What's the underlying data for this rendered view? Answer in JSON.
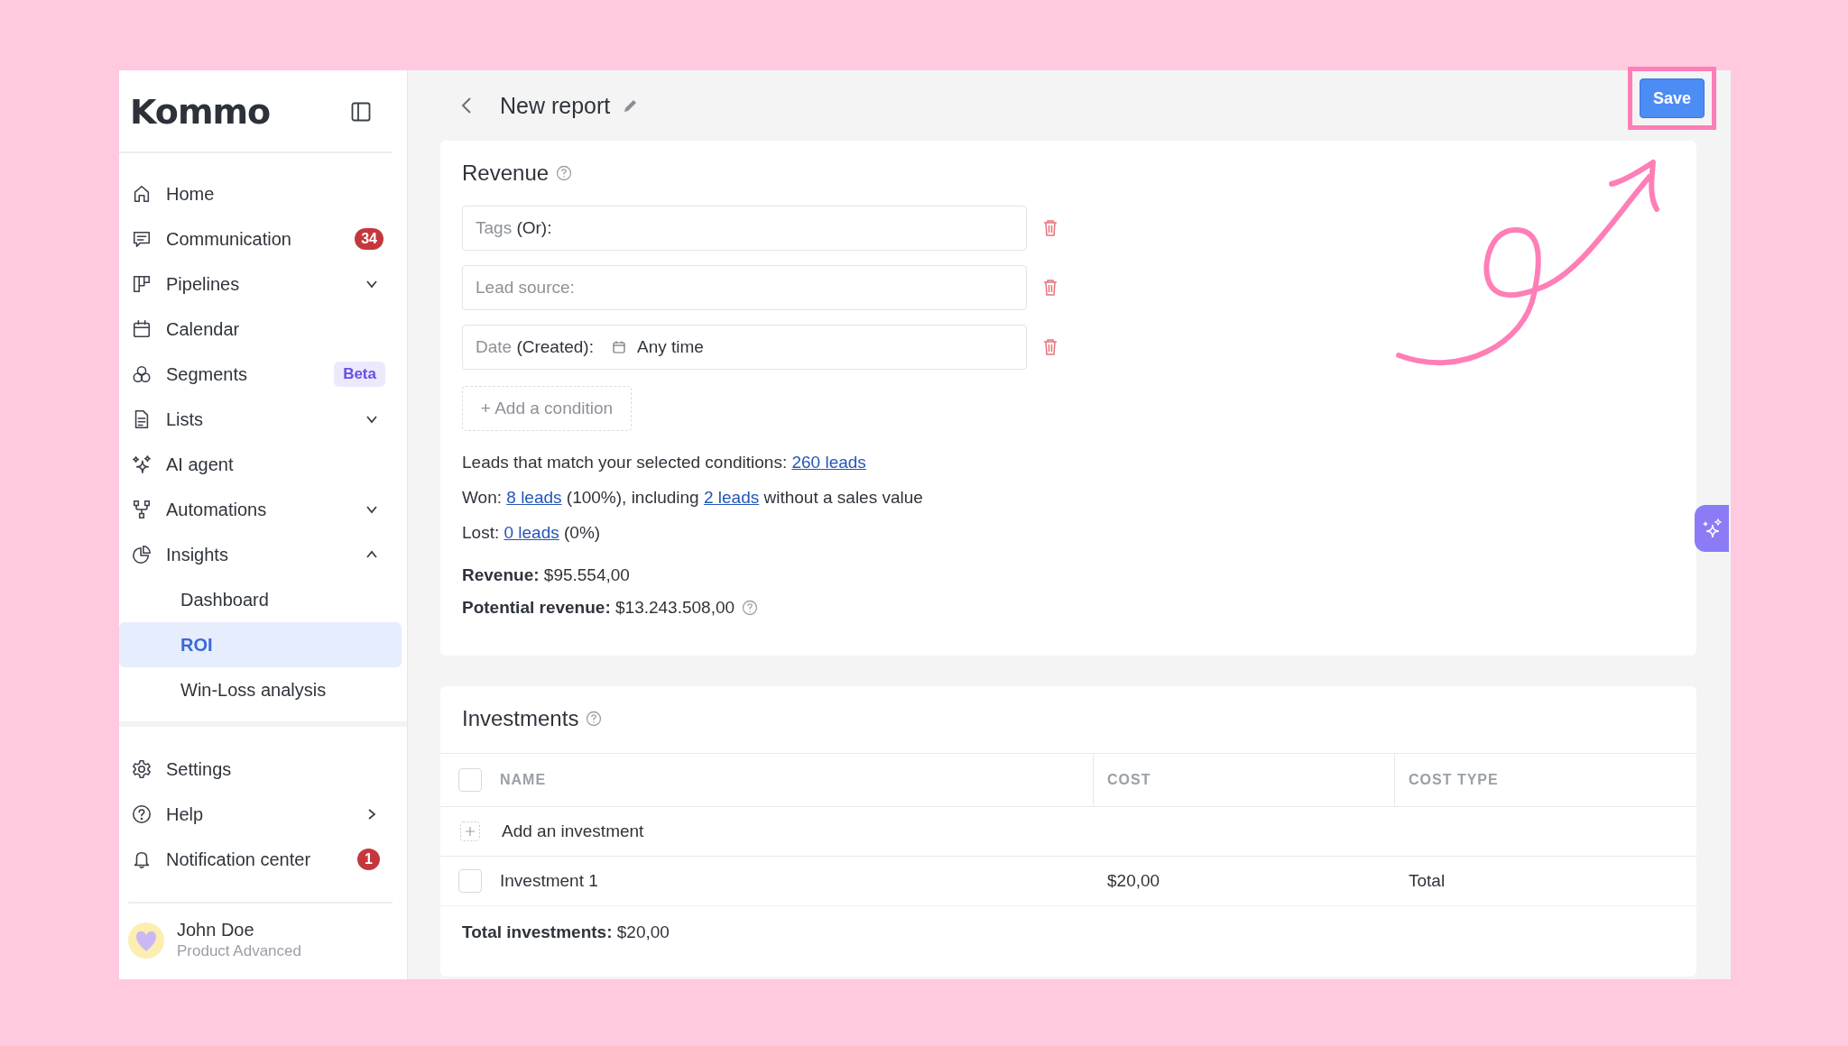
{
  "sidebar": {
    "logo": "Kommo",
    "nav": [
      {
        "label": "Home",
        "selected": false
      },
      {
        "label": "Communication",
        "selected": false,
        "badge": {
          "text": "34",
          "kind": "count"
        }
      },
      {
        "label": "Pipelines",
        "selected": false,
        "expanded": false
      },
      {
        "label": "Calendar",
        "selected": false
      },
      {
        "label": "Segments",
        "selected": false,
        "badge": {
          "text": "Beta",
          "kind": "tag"
        }
      },
      {
        "label": "Lists",
        "selected": false,
        "expanded": false
      },
      {
        "label": "AI agent",
        "selected": false
      },
      {
        "label": "Automations",
        "selected": false,
        "expanded": false
      },
      {
        "label": "Insights",
        "selected": false,
        "expanded": true,
        "children": [
          {
            "label": "Dashboard",
            "selected": false
          },
          {
            "label": "ROI",
            "selected": true
          },
          {
            "label": "Win-Loss analysis",
            "selected": false
          }
        ]
      }
    ],
    "bottom_nav": [
      {
        "label": "Settings",
        "selected": false
      },
      {
        "label": "Help",
        "selected": false,
        "submenu": true
      },
      {
        "label": "Notification center",
        "selected": false,
        "badge": {
          "text": "1",
          "kind": "count"
        }
      }
    ],
    "user": {
      "name": "John Doe",
      "plan": "Product Advanced"
    }
  },
  "header": {
    "title": "New report",
    "save_button": {
      "label": "Save",
      "highlighted": true
    }
  },
  "revenue": {
    "title": "Revenue",
    "conditions": [
      {
        "label": "Tags",
        "qualifier": "(Or):"
      },
      {
        "label": "Lead source:"
      },
      {
        "label": "Date",
        "qualifier": "(Created):",
        "value": "Any time"
      }
    ],
    "add_condition": "+ Add a condition",
    "summary": [
      [
        {
          "text": "Leads that match your selected conditions: "
        },
        {
          "text": "260 leads",
          "link": true
        }
      ],
      [
        {
          "text": "Won: "
        },
        {
          "text": "8 leads",
          "link": true
        },
        {
          "text": " (100%), including "
        },
        {
          "text": "2 leads",
          "link": true
        },
        {
          "text": " without a sales value"
        }
      ],
      [
        {
          "text": "Lost: "
        },
        {
          "text": "0 leads",
          "link": true
        },
        {
          "text": " (0%)"
        }
      ]
    ],
    "totals": [
      {
        "text": "**Revenue:** $95.554,00",
        "help": false
      },
      {
        "text": "**Potential revenue:** $13.243.508,00",
        "help": true
      }
    ]
  },
  "investments": {
    "title": "Investments",
    "select_all_checked": false,
    "columns": [
      "NAME",
      "COST",
      "COST TYPE"
    ],
    "add_row": "Add an investment",
    "rows": [
      {
        "name": "Investment 1",
        "cost": "$20,00",
        "cost_type": "Total",
        "checked": false
      }
    ],
    "total": "**Total investments:** $20,00"
  }
}
